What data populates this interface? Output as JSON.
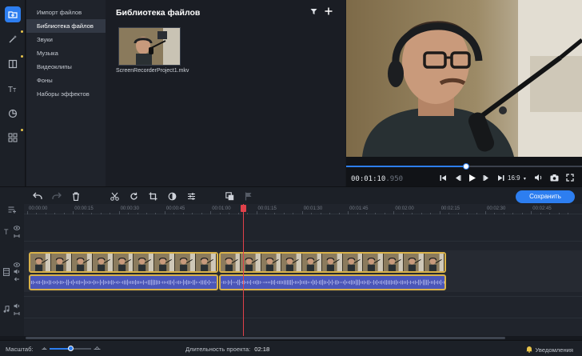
{
  "sidebar": {
    "icons": [
      "import-icon",
      "magic-wand-icon",
      "transitions-icon",
      "titles-icon",
      "stickers-icon",
      "more-tools-icon"
    ],
    "categories": [
      {
        "label": "Импорт файлов"
      },
      {
        "label": "Библиотека файлов",
        "selected": true
      },
      {
        "label": "Звуки"
      },
      {
        "label": "Музыка"
      },
      {
        "label": "Видеоклипы"
      },
      {
        "label": "Фоны"
      },
      {
        "label": "Наборы эффектов"
      }
    ]
  },
  "library": {
    "title": "Библиотека файлов",
    "file": {
      "name": "ScreenRecorderProject1.mkv"
    }
  },
  "player": {
    "timecode_main": "00:01:10",
    "timecode_ms": ".950",
    "progress_fraction": 0.51,
    "aspect_ratio": "16:9"
  },
  "toolbar": {
    "save_label": "Сохранить"
  },
  "timeline": {
    "ticks": [
      "00:00:00",
      "00:00:15",
      "00:00:30",
      "00:00:45",
      "00:01:00",
      "00:01:15",
      "00:01:30",
      "00:01:45",
      "00:02:00",
      "00:02:15",
      "00:02:30",
      "00:02:45"
    ]
  },
  "status": {
    "zoom_label": "Масштаб:",
    "zoom_fraction": 0.5,
    "duration_label": "Длительность проекта:",
    "duration_value": "02:18",
    "notifications_label": "Уведомления"
  },
  "colors": {
    "accent": "#2d7ef0",
    "clip_border": "#d9b24a",
    "audio_wave": "#4b56b8",
    "playhead": "#e0414a"
  }
}
